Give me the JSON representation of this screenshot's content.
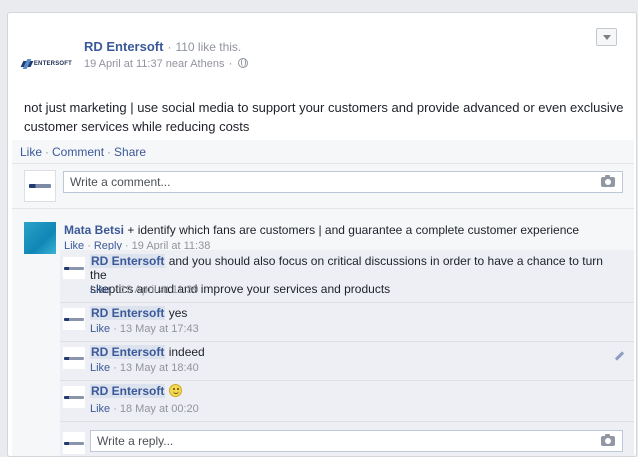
{
  "post": {
    "author": "RD Entersoft",
    "likes": "110 like this.",
    "timestamp": "19 April at 11:37 near Athens",
    "text": "not just marketing | use social media to support your customers and provide advanced or even exclusive customer services while reducing costs",
    "logo_text": "ENTERSOFT"
  },
  "actions": {
    "like": "Like",
    "comment": "Comment",
    "share": "Share"
  },
  "comment_input": {
    "placeholder": "Write a comment..."
  },
  "comments": [
    {
      "author": "Mata Betsi",
      "text": "+ identify which fans are customers | and guarantee a complete customer experience",
      "like": "Like",
      "reply": "Reply",
      "time": "19 April at 11:38"
    }
  ],
  "replies": [
    {
      "author": "RD Entersoft",
      "text_line1": "and you should also focus on critical discussions in order to have a chance to turn the",
      "text_line2": "skeptics around and improve your services and products",
      "like": "Like",
      "time": "19 April at 11:39"
    },
    {
      "author": "RD Entersoft",
      "text": "yes",
      "like": "Like",
      "time": "13 May at 17:43"
    },
    {
      "author": "RD Entersoft",
      "text": "indeed",
      "like": "Like",
      "time": "13 May at 18:40"
    },
    {
      "author": "RD Entersoft",
      "text": "",
      "like": "Like",
      "time": "18 May at 00:20"
    }
  ],
  "reply_input": {
    "placeholder": "Write a reply..."
  },
  "separator": "·",
  "icons": {
    "privacy": "globe-icon",
    "menu": "chevron-down-icon",
    "photo": "camera-icon",
    "edit": "pencil-icon",
    "emoji": "smile-icon"
  },
  "colors": {
    "link": "#3b5998",
    "muted": "#90949c",
    "ufi_bg": "#f6f7f9",
    "reply_bg": "#edeff4"
  }
}
